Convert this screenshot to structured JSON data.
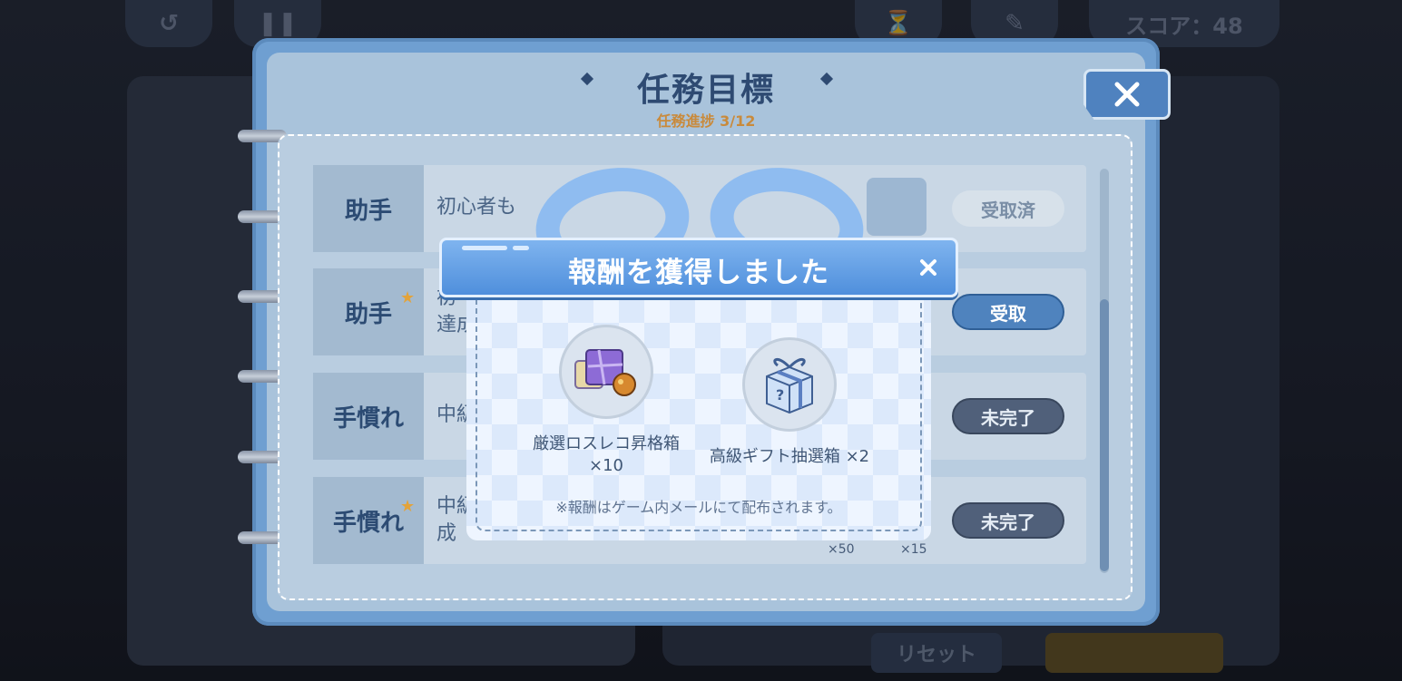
{
  "hud": {
    "score_label": "スコア：48",
    "undo_icon": "undo-icon",
    "pause_icon": "pause-icon"
  },
  "background": {
    "reset_label": "リセット"
  },
  "mission": {
    "title": "任務目標",
    "progress": "任務進捗 3/12",
    "tasks": [
      {
        "label": "助手",
        "starred": false,
        "desc": "初心者も",
        "button": "受取済",
        "state": "claimed"
      },
      {
        "label": "助手",
        "starred": true,
        "desc": "初\n達成",
        "button": "受取",
        "state": "claim"
      },
      {
        "label": "手慣れ",
        "starred": false,
        "desc": "中級",
        "button": "未完了",
        "state": "incomplete"
      },
      {
        "label": "手慣れ",
        "starred": true,
        "desc": "中級\n成",
        "button": "未完了",
        "state": "incomplete"
      }
    ],
    "reward_qty_a": "×50",
    "reward_qty_b": "×15"
  },
  "popup": {
    "title": "報酬を獲得しました",
    "rewards": [
      {
        "name_line1": "厳選ロスレコ昇格箱",
        "name_line2": "×10",
        "icon": "upgrade-box-icon"
      },
      {
        "name_line1": "高級ギフト抽選箱 ×2",
        "icon": "mystery-gift-box-icon"
      }
    ],
    "note": "※報酬はゲーム内メールにて配布されます。"
  },
  "colors": {
    "accent": "#4f8fdc",
    "title": "#2e4a72",
    "progress": "#c98a3b"
  }
}
